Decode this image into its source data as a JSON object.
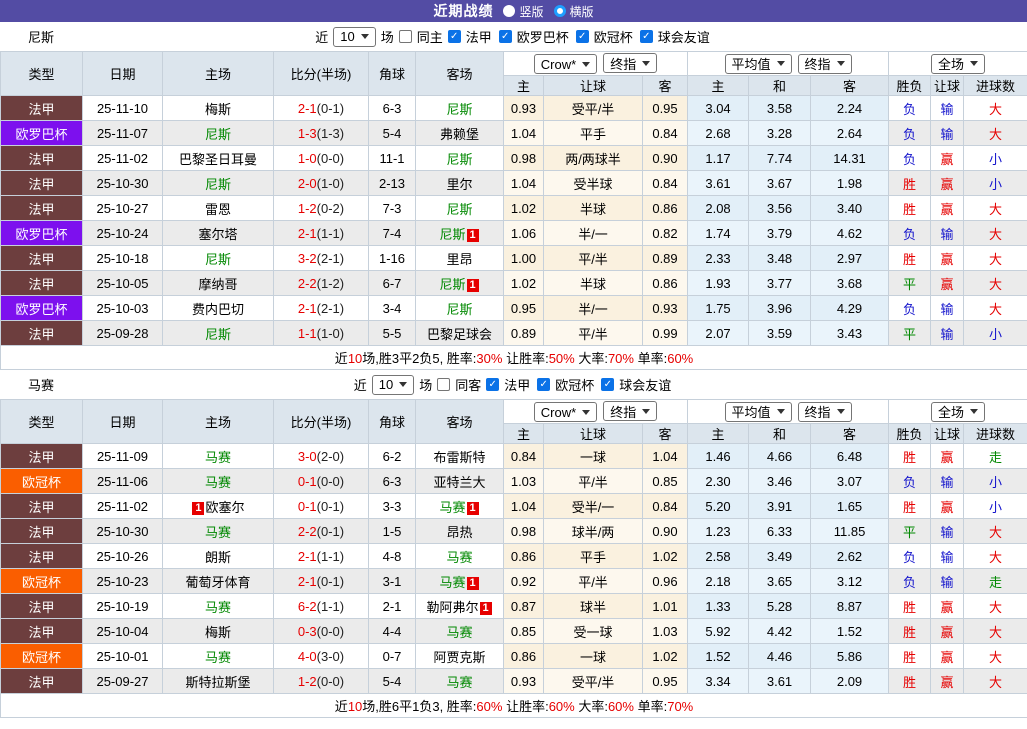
{
  "topbar": {
    "title": "近期战绩",
    "options": [
      {
        "label": "竖版",
        "checked": false
      },
      {
        "label": "横版",
        "checked": true
      }
    ]
  },
  "sections": [
    {
      "team": "尼斯",
      "filters": {
        "near": "近",
        "games": "10",
        "unit": "场",
        "same_label": "同主",
        "leagues": [
          "法甲",
          "欧罗巴杯",
          "欧冠杯",
          "球会友谊"
        ]
      },
      "dropdowns": {
        "book": "Crow*",
        "book_type": "终指",
        "avg": "平均值",
        "avg_type": "终指",
        "scope": "全场"
      },
      "left_headers": [
        "类型",
        "日期",
        "主场",
        "比分(半场)",
        "角球",
        "客场"
      ],
      "sub_headers": [
        "主",
        "让球",
        "客",
        "主",
        "和",
        "客",
        "胜负",
        "让球",
        "进球数"
      ],
      "rows": [
        {
          "type": "法甲",
          "date": "25-11-10",
          "home": "梅斯",
          "home_red": "",
          "score": "2-1",
          "half": "(0-1)",
          "corner": "6-3",
          "away": "尼斯",
          "away_red": "",
          "h_home": "0.93",
          "handicap": "受平/半",
          "h_away": "0.95",
          "avg_home": "3.04",
          "avg_draw": "3.58",
          "avg_away": "2.24",
          "result": "负",
          "asian": "输",
          "goals": "大"
        },
        {
          "type": "欧罗巴杯",
          "date": "25-11-07",
          "home": "尼斯",
          "home_red": "",
          "score": "1-3",
          "half": "(1-3)",
          "corner": "5-4",
          "away": "弗赖堡",
          "away_red": "",
          "h_home": "1.04",
          "handicap": "平手",
          "h_away": "0.84",
          "avg_home": "2.68",
          "avg_draw": "3.28",
          "avg_away": "2.64",
          "result": "负",
          "asian": "输",
          "goals": "大"
        },
        {
          "type": "法甲",
          "date": "25-11-02",
          "home": "巴黎圣日耳曼",
          "home_red": "",
          "score": "1-0",
          "half": "(0-0)",
          "corner": "11-1",
          "away": "尼斯",
          "away_red": "",
          "h_home": "0.98",
          "handicap": "两/两球半",
          "h_away": "0.90",
          "avg_home": "1.17",
          "avg_draw": "7.74",
          "avg_away": "14.31",
          "result": "负",
          "asian": "赢",
          "goals": "小"
        },
        {
          "type": "法甲",
          "date": "25-10-30",
          "home": "尼斯",
          "home_red": "",
          "score": "2-0",
          "half": "(1-0)",
          "corner": "2-13",
          "away": "里尔",
          "away_red": "",
          "h_home": "1.04",
          "handicap": "受半球",
          "h_away": "0.84",
          "avg_home": "3.61",
          "avg_draw": "3.67",
          "avg_away": "1.98",
          "result": "胜",
          "asian": "赢",
          "goals": "小"
        },
        {
          "type": "法甲",
          "date": "25-10-27",
          "home": "雷恩",
          "home_red": "",
          "score": "1-2",
          "half": "(0-2)",
          "corner": "7-3",
          "away": "尼斯",
          "away_red": "",
          "h_home": "1.02",
          "handicap": "半球",
          "h_away": "0.86",
          "avg_home": "2.08",
          "avg_draw": "3.56",
          "avg_away": "3.40",
          "result": "胜",
          "asian": "赢",
          "goals": "大"
        },
        {
          "type": "欧罗巴杯",
          "date": "25-10-24",
          "home": "塞尔塔",
          "home_red": "",
          "score": "2-1",
          "half": "(1-1)",
          "corner": "7-4",
          "away": "尼斯",
          "away_red": "1",
          "h_home": "1.06",
          "handicap": "半/一",
          "h_away": "0.82",
          "avg_home": "1.74",
          "avg_draw": "3.79",
          "avg_away": "4.62",
          "result": "负",
          "asian": "输",
          "goals": "大"
        },
        {
          "type": "法甲",
          "date": "25-10-18",
          "home": "尼斯",
          "home_red": "",
          "score": "3-2",
          "half": "(2-1)",
          "corner": "1-16",
          "away": "里昂",
          "away_red": "",
          "h_home": "1.00",
          "handicap": "平/半",
          "h_away": "0.89",
          "avg_home": "2.33",
          "avg_draw": "3.48",
          "avg_away": "2.97",
          "result": "胜",
          "asian": "赢",
          "goals": "大"
        },
        {
          "type": "法甲",
          "date": "25-10-05",
          "home": "摩纳哥",
          "home_red": "",
          "score": "2-2",
          "half": "(1-2)",
          "corner": "6-7",
          "away": "尼斯",
          "away_red": "1",
          "h_home": "1.02",
          "handicap": "半球",
          "h_away": "0.86",
          "avg_home": "1.93",
          "avg_draw": "3.77",
          "avg_away": "3.68",
          "result": "平",
          "asian": "赢",
          "goals": "大"
        },
        {
          "type": "欧罗巴杯",
          "date": "25-10-03",
          "home": "费内巴切",
          "home_red": "",
          "score": "2-1",
          "half": "(2-1)",
          "corner": "3-4",
          "away": "尼斯",
          "away_red": "",
          "h_home": "0.95",
          "handicap": "半/一",
          "h_away": "0.93",
          "avg_home": "1.75",
          "avg_draw": "3.96",
          "avg_away": "4.29",
          "result": "负",
          "asian": "输",
          "goals": "大"
        },
        {
          "type": "法甲",
          "date": "25-09-28",
          "home": "尼斯",
          "home_red": "",
          "score": "1-1",
          "half": "(1-0)",
          "corner": "5-5",
          "away": "巴黎足球会",
          "away_red": "",
          "h_home": "0.89",
          "handicap": "平/半",
          "h_away": "0.99",
          "avg_home": "2.07",
          "avg_draw": "3.59",
          "avg_away": "3.43",
          "result": "平",
          "asian": "输",
          "goals": "小"
        }
      ],
      "summary": [
        {
          "text": "近",
          "red": false
        },
        {
          "text": "10",
          "red": true
        },
        {
          "text": "场,胜3平2负5, 胜率:",
          "red": false
        },
        {
          "text": "30%",
          "red": true
        },
        {
          "text": " 让胜率:",
          "red": false
        },
        {
          "text": "50%",
          "red": true
        },
        {
          "text": " 大率:",
          "red": false
        },
        {
          "text": "70%",
          "red": true
        },
        {
          "text": " 单率:",
          "red": false
        },
        {
          "text": "60%",
          "red": true
        }
      ]
    },
    {
      "team": "马赛",
      "filters": {
        "near": "近",
        "games": "10",
        "unit": "场",
        "same_label": "同客",
        "leagues": [
          "法甲",
          "欧冠杯",
          "球会友谊"
        ]
      },
      "dropdowns": {
        "book": "Crow*",
        "book_type": "终指",
        "avg": "平均值",
        "avg_type": "终指",
        "scope": "全场"
      },
      "left_headers": [
        "类型",
        "日期",
        "主场",
        "比分(半场)",
        "角球",
        "客场"
      ],
      "sub_headers": [
        "主",
        "让球",
        "客",
        "主",
        "和",
        "客",
        "胜负",
        "让球",
        "进球数"
      ],
      "rows": [
        {
          "type": "法甲",
          "date": "25-11-09",
          "home": "马赛",
          "home_red": "",
          "score": "3-0",
          "half": "(2-0)",
          "corner": "6-2",
          "away": "布雷斯特",
          "away_red": "",
          "h_home": "0.84",
          "handicap": "一球",
          "h_away": "1.04",
          "avg_home": "1.46",
          "avg_draw": "4.66",
          "avg_away": "6.48",
          "result": "胜",
          "asian": "赢",
          "goals": "走"
        },
        {
          "type": "欧冠杯",
          "date": "25-11-06",
          "home": "马赛",
          "home_red": "",
          "score": "0-1",
          "half": "(0-0)",
          "corner": "6-3",
          "away": "亚特兰大",
          "away_red": "",
          "h_home": "1.03",
          "handicap": "平/半",
          "h_away": "0.85",
          "avg_home": "2.30",
          "avg_draw": "3.46",
          "avg_away": "3.07",
          "result": "负",
          "asian": "输",
          "goals": "小"
        },
        {
          "type": "法甲",
          "date": "25-11-02",
          "home": "欧塞尔",
          "home_red": "1",
          "score": "0-1",
          "half": "(0-1)",
          "corner": "3-3",
          "away": "马赛",
          "away_red": "1",
          "h_home": "1.04",
          "handicap": "受半/一",
          "h_away": "0.84",
          "avg_home": "5.20",
          "avg_draw": "3.91",
          "avg_away": "1.65",
          "result": "胜",
          "asian": "赢",
          "goals": "小"
        },
        {
          "type": "法甲",
          "date": "25-10-30",
          "home": "马赛",
          "home_red": "",
          "score": "2-2",
          "half": "(0-1)",
          "corner": "1-5",
          "away": "昂热",
          "away_red": "",
          "h_home": "0.98",
          "handicap": "球半/两",
          "h_away": "0.90",
          "avg_home": "1.23",
          "avg_draw": "6.33",
          "avg_away": "11.85",
          "result": "平",
          "asian": "输",
          "goals": "大"
        },
        {
          "type": "法甲",
          "date": "25-10-26",
          "home": "朗斯",
          "home_red": "",
          "score": "2-1",
          "half": "(1-1)",
          "corner": "4-8",
          "away": "马赛",
          "away_red": "",
          "h_home": "0.86",
          "handicap": "平手",
          "h_away": "1.02",
          "avg_home": "2.58",
          "avg_draw": "3.49",
          "avg_away": "2.62",
          "result": "负",
          "asian": "输",
          "goals": "大"
        },
        {
          "type": "欧冠杯",
          "date": "25-10-23",
          "home": "葡萄牙体育",
          "home_red": "",
          "score": "2-1",
          "half": "(0-1)",
          "corner": "3-1",
          "away": "马赛",
          "away_red": "1",
          "h_home": "0.92",
          "handicap": "平/半",
          "h_away": "0.96",
          "avg_home": "2.18",
          "avg_draw": "3.65",
          "avg_away": "3.12",
          "result": "负",
          "asian": "输",
          "goals": "走"
        },
        {
          "type": "法甲",
          "date": "25-10-19",
          "home": "马赛",
          "home_red": "",
          "score": "6-2",
          "half": "(1-1)",
          "corner": "2-1",
          "away": "勒阿弗尔",
          "away_red": "1",
          "h_home": "0.87",
          "handicap": "球半",
          "h_away": "1.01",
          "avg_home": "1.33",
          "avg_draw": "5.28",
          "avg_away": "8.87",
          "result": "胜",
          "asian": "赢",
          "goals": "大"
        },
        {
          "type": "法甲",
          "date": "25-10-04",
          "home": "梅斯",
          "home_red": "",
          "score": "0-3",
          "half": "(0-0)",
          "corner": "4-4",
          "away": "马赛",
          "away_red": "",
          "h_home": "0.85",
          "handicap": "受一球",
          "h_away": "1.03",
          "avg_home": "5.92",
          "avg_draw": "4.42",
          "avg_away": "1.52",
          "result": "胜",
          "asian": "赢",
          "goals": "大"
        },
        {
          "type": "欧冠杯",
          "date": "25-10-01",
          "home": "马赛",
          "home_red": "",
          "score": "4-0",
          "half": "(3-0)",
          "corner": "0-7",
          "away": "阿贾克斯",
          "away_red": "",
          "h_home": "0.86",
          "handicap": "一球",
          "h_away": "1.02",
          "avg_home": "1.52",
          "avg_draw": "4.46",
          "avg_away": "5.86",
          "result": "胜",
          "asian": "赢",
          "goals": "大"
        },
        {
          "type": "法甲",
          "date": "25-09-27",
          "home": "斯特拉斯堡",
          "home_red": "",
          "score": "1-2",
          "half": "(0-0)",
          "corner": "5-4",
          "away": "马赛",
          "away_red": "",
          "h_home": "0.93",
          "handicap": "受平/半",
          "h_away": "0.95",
          "avg_home": "3.34",
          "avg_draw": "3.61",
          "avg_away": "2.09",
          "result": "胜",
          "asian": "赢",
          "goals": "大"
        }
      ],
      "summary": [
        {
          "text": "近",
          "red": false
        },
        {
          "text": "10",
          "red": true
        },
        {
          "text": "场,胜6平1负3, 胜率:",
          "red": false
        },
        {
          "text": "60%",
          "red": true
        },
        {
          "text": " 让胜率:",
          "red": false
        },
        {
          "text": "60%",
          "red": true
        },
        {
          "text": " 大率:",
          "red": false
        },
        {
          "text": "60%",
          "red": true
        },
        {
          "text": " 单率:",
          "red": false
        },
        {
          "text": "70%",
          "red": true
        }
      ]
    }
  ]
}
